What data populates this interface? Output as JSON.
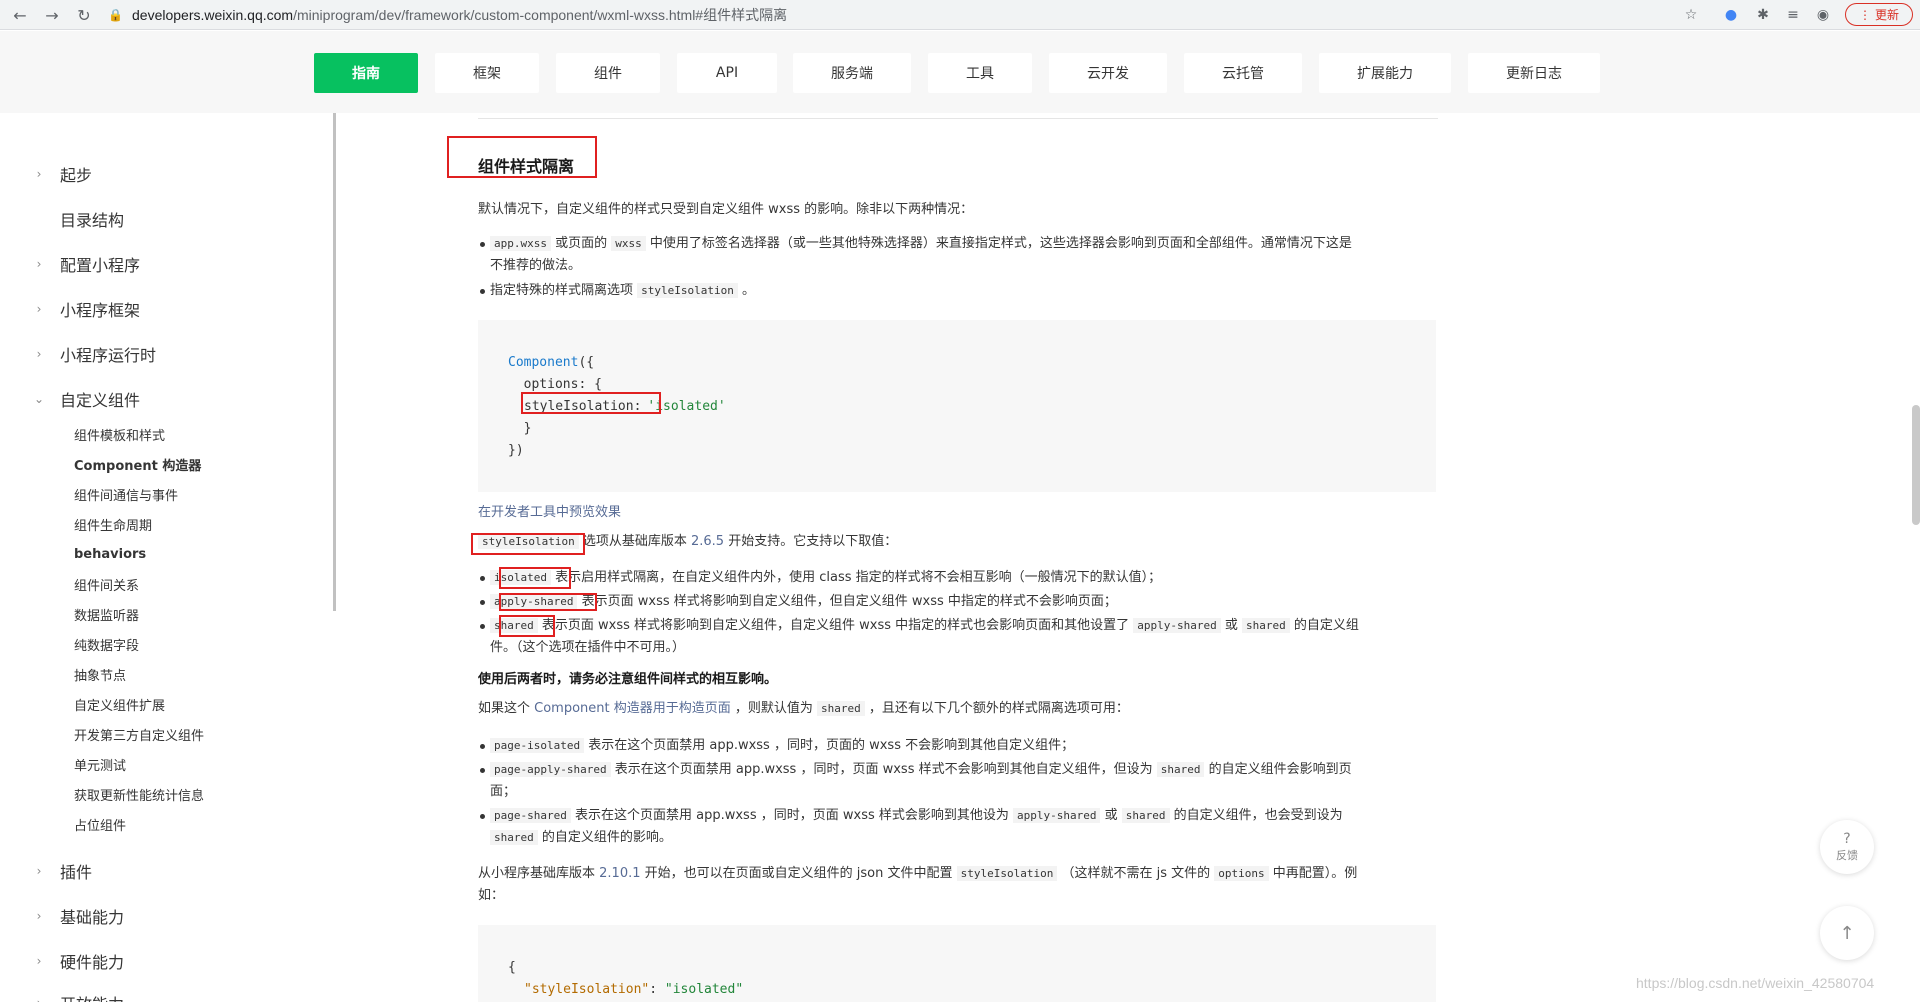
{
  "browser": {
    "url_host": "developers.weixin.qq.com",
    "url_path": "/miniprogram/dev/framework/custom-component/wxml-wxss.html#组件样式隔离",
    "update_label": "更新"
  },
  "tabs": [
    "指南",
    "框架",
    "组件",
    "API",
    "服务端",
    "工具",
    "云开发",
    "云托管",
    "扩展能力",
    "更新日志"
  ],
  "sidebar": {
    "top_items": [
      {
        "label": "起步",
        "chevron": "›"
      },
      {
        "label": "目录结构",
        "chevron": ""
      },
      {
        "label": "配置小程序",
        "chevron": "›"
      },
      {
        "label": "小程序框架",
        "chevron": "›"
      },
      {
        "label": "小程序运行时",
        "chevron": "›"
      },
      {
        "label": "自定义组件",
        "chevron": "⌄"
      }
    ],
    "sub_items": [
      "组件模板和样式",
      "Component 构造器",
      "组件间通信与事件",
      "组件生命周期",
      "behaviors",
      "组件间关系",
      "数据监听器",
      "纯数据字段",
      "抽象节点",
      "自定义组件扩展",
      "开发第三方自定义组件",
      "单元测试",
      "获取更新性能统计信息",
      "占位组件"
    ],
    "bottom_items": [
      {
        "label": "插件",
        "chevron": "›"
      },
      {
        "label": "基础能力",
        "chevron": "›"
      },
      {
        "label": "硬件能力",
        "chevron": "›"
      },
      {
        "label": "开放能力",
        "chevron": "›"
      }
    ]
  },
  "content": {
    "heading": "组件样式隔离",
    "intro": "默认情况下，自定义组件的样式只受到自定义组件 wxss 的影响。除非以下两种情况：",
    "b1": {
      "c1": "app.wxss",
      "t1": " 或页面的 ",
      "c2": "wxss",
      "t2": " 中使用了标签名选择器（或一些其他特殊选择器）来直接指定样式，这些选择器会影响到页面和全部组件。通常情况下这是",
      "t3": "不推荐的做法。"
    },
    "b2": {
      "t1": "指定特殊的样式隔离选项 ",
      "c1": "styleIsolation",
      "t2": " 。"
    },
    "code1": {
      "l1_kw": "Component",
      "l1_rest": "({",
      "l2": "  options: {",
      "l3_key": "styleIsolation:",
      "l3_val": "'isolated'",
      "l4": "  }",
      "l5": "})"
    },
    "preview_link": "在开发者工具中预览效果",
    "support": {
      "c1": "styleIsolation",
      "t1": " 选项从基础库版本 ",
      "link": "2.6.5",
      "t2": " 开始支持。它支持以下取值："
    },
    "vals": {
      "v1c": "isolated",
      "v1t": " 表示启用样式隔离，在自定义组件内外，使用 class 指定的样式将不会相互影响（一般情况下的默认值）；",
      "v2c": "apply-shared",
      "v2t": " 表示页面 wxss 样式将影响到自定义组件，但自定义组件 wxss 中指定的样式不会影响页面；",
      "v3c": "shared",
      "v3t1": " 表示页面 wxss 样式将影响到自定义组件，自定义组件 wxss 中指定的样式也会影响页面和其他设置了 ",
      "v3c2": "apply-shared",
      "v3t2": " 或 ",
      "v3c3": "shared",
      "v3t3": " 的自定义组",
      "v3t4": "件。（这个选项在插件中不可用。）"
    },
    "warn": "使用后两者时，请务必注意组件间样式的相互影响。",
    "page": {
      "t1": "如果这个 ",
      "link": "Component 构造器用于构造页面",
      "t2": " ，则默认值为 ",
      "c1": "shared",
      "t3": " ，且还有以下几个额外的样式隔离选项可用："
    },
    "pb": {
      "p1c": "page-isolated",
      "p1t": " 表示在这个页面禁用 app.wxss ，同时，页面的 wxss 不会影响到其他自定义组件；",
      "p2c": "page-apply-shared",
      "p2t1": " 表示在这个页面禁用 app.wxss ，同时，页面 wxss 样式不会影响到其他自定义组件，但设为 ",
      "p2c2": "shared",
      "p2t2": " 的自定义组件会影响到页",
      "p2t3": "面；",
      "p3c": "page-shared",
      "p3t1": " 表示在这个页面禁用 app.wxss ，同时，页面 wxss 样式会影响到其他设为 ",
      "p3c2": "apply-shared",
      "p3t2": " 或 ",
      "p3c3": "shared",
      "p3t3": " 的自定义组件，也会受到设为",
      "p3c4": "shared",
      "p3t4": " 的自定义组件的影响。"
    },
    "json": {
      "t1": "从小程序基础库版本 ",
      "link": "2.10.1",
      "t2": " 开始，也可以在页面或自定义组件的 json 文件中配置 ",
      "c1": "styleIsolation",
      "t3": " （这样就不需在 js 文件的 ",
      "c2": "options",
      "t4": " 中再配置）。例",
      "t5": "如："
    },
    "code2": {
      "l1": "{",
      "l2_key": "\"styleIsolation\"",
      "l2_sep": ": ",
      "l2_val": "\"isolated\""
    }
  },
  "float": {
    "help_q": "?",
    "help_label": "反馈",
    "top_arrow": "↑"
  },
  "watermark": "https://blog.csdn.net/weixin_42580704"
}
